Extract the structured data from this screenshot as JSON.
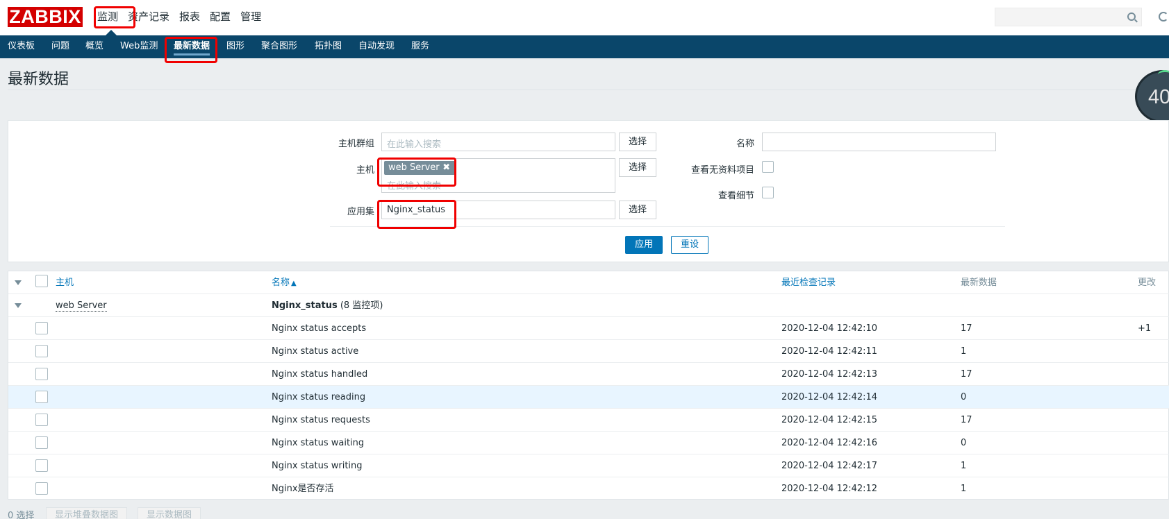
{
  "logo": "ZABBIX",
  "main_menu": [
    "监测",
    "资产记录",
    "报表",
    "配置",
    "管理"
  ],
  "sub_menu": [
    "仪表板",
    "问题",
    "概览",
    "Web监测",
    "最新数据",
    "图形",
    "聚合图形",
    "拓扑图",
    "自动发现",
    "服务"
  ],
  "page_title": "最新数据",
  "refresh_counter": "40",
  "filter": {
    "host_group_label": "主机群组",
    "host_group_placeholder": "在此输入搜索",
    "host_label": "主机",
    "host_tag": "web Server",
    "host_placeholder": "在此输入搜索",
    "application_label": "应用集",
    "application_value": "Nginx_status",
    "select_label": "选择",
    "name_label": "名称",
    "show_no_data_label": "查看无资料项目",
    "show_details_label": "查看细节",
    "apply_label": "应用",
    "reset_label": "重设"
  },
  "table": {
    "headers": {
      "host": "主机",
      "name": "名称",
      "name_sort": "▲",
      "last_check": "最近检查记录",
      "last_value": "最新数据",
      "change": "更改"
    },
    "group": {
      "host": "web Server",
      "application": "Nginx_status",
      "count": "(8 监控项)"
    },
    "rows": [
      {
        "name": "Nginx status accepts",
        "last_check": "2020-12-04 12:42:10",
        "last_value": "17",
        "change": "+1"
      },
      {
        "name": "Nginx status active",
        "last_check": "2020-12-04 12:42:11",
        "last_value": "1",
        "change": ""
      },
      {
        "name": "Nginx status handled",
        "last_check": "2020-12-04 12:42:13",
        "last_value": "17",
        "change": ""
      },
      {
        "name": "Nginx status reading",
        "last_check": "2020-12-04 12:42:14",
        "last_value": "0",
        "change": ""
      },
      {
        "name": "Nginx status requests",
        "last_check": "2020-12-04 12:42:15",
        "last_value": "17",
        "change": ""
      },
      {
        "name": "Nginx status waiting",
        "last_check": "2020-12-04 12:42:16",
        "last_value": "0",
        "change": ""
      },
      {
        "name": "Nginx status writing",
        "last_check": "2020-12-04 12:42:17",
        "last_value": "1",
        "change": ""
      },
      {
        "name": "Nginx是否存活",
        "last_check": "2020-12-04 12:42:12",
        "last_value": "1",
        "change": ""
      }
    ]
  },
  "footer": {
    "selected": "0 选择",
    "stacked_graph_button": "显示堆叠数据图",
    "graph_button": "显示数据图"
  },
  "colors": {
    "brand_red": "#d40000",
    "nav_blue": "#0a466a",
    "link_blue": "#0275b8",
    "annotation_red": "#f00000",
    "highlight_row": "#e8f5ff"
  }
}
